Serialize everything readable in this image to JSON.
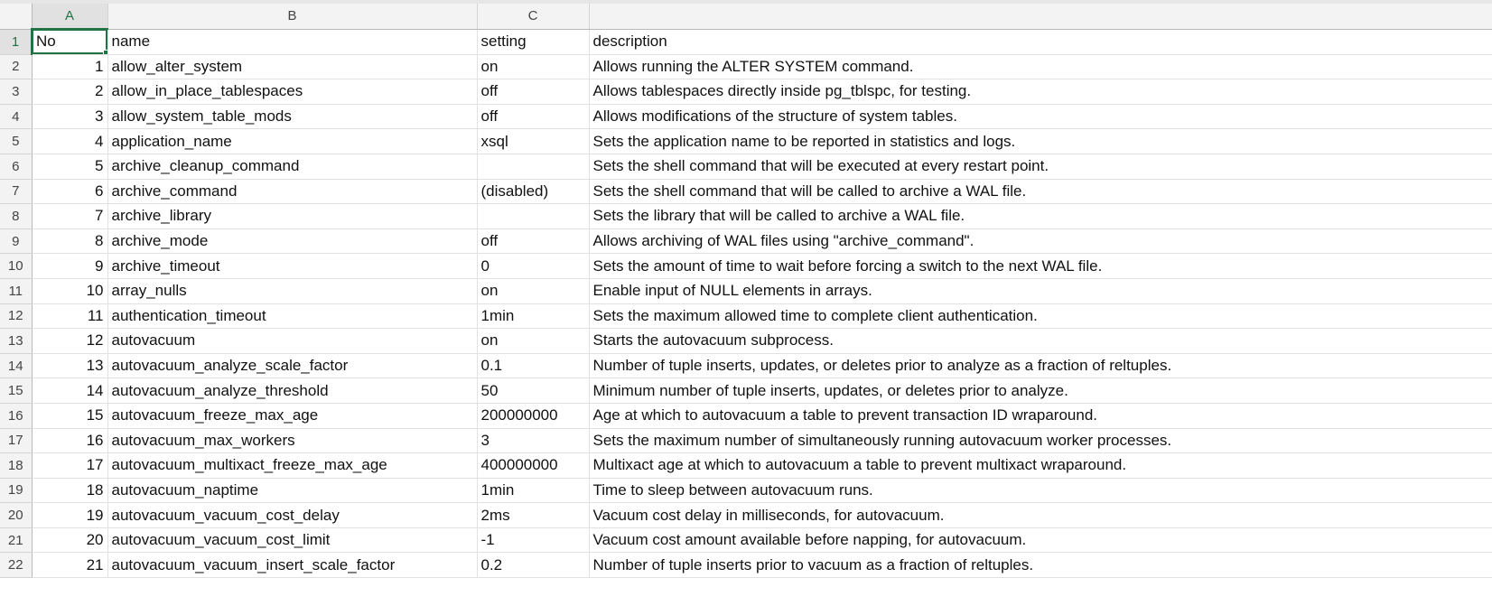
{
  "columns": [
    "A",
    "B",
    "C"
  ],
  "header_row": {
    "row_number": "1",
    "no": "No",
    "name": "name",
    "setting": "setting",
    "description": "description"
  },
  "rows": [
    {
      "row_number": "2",
      "no": "1",
      "name": "allow_alter_system",
      "setting": "on",
      "description": "Allows running the ALTER SYSTEM command."
    },
    {
      "row_number": "3",
      "no": "2",
      "name": "allow_in_place_tablespaces",
      "setting": "off",
      "description": "Allows tablespaces directly inside pg_tblspc, for testing."
    },
    {
      "row_number": "4",
      "no": "3",
      "name": "allow_system_table_mods",
      "setting": "off",
      "description": "Allows modifications of the structure of system tables."
    },
    {
      "row_number": "5",
      "no": "4",
      "name": "application_name",
      "setting": "xsql",
      "description": "Sets the application name to be reported in statistics and logs."
    },
    {
      "row_number": "6",
      "no": "5",
      "name": "archive_cleanup_command",
      "setting": "",
      "description": "Sets the shell command that will be executed at every restart point."
    },
    {
      "row_number": "7",
      "no": "6",
      "name": "archive_command",
      "setting": "(disabled)",
      "description": "Sets the shell command that will be called to archive a WAL file."
    },
    {
      "row_number": "8",
      "no": "7",
      "name": "archive_library",
      "setting": "",
      "description": "Sets the library that will be called to archive a WAL file."
    },
    {
      "row_number": "9",
      "no": "8",
      "name": "archive_mode",
      "setting": "off",
      "description": "Allows archiving of WAL files using \"archive_command\"."
    },
    {
      "row_number": "10",
      "no": "9",
      "name": "archive_timeout",
      "setting": "0",
      "description": "Sets the amount of time to wait before forcing a switch to the next WAL file."
    },
    {
      "row_number": "11",
      "no": "10",
      "name": "array_nulls",
      "setting": "on",
      "description": "Enable input of NULL elements in arrays."
    },
    {
      "row_number": "12",
      "no": "11",
      "name": "authentication_timeout",
      "setting": "1min",
      "description": "Sets the maximum allowed time to complete client authentication."
    },
    {
      "row_number": "13",
      "no": "12",
      "name": "autovacuum",
      "setting": "on",
      "description": "Starts the autovacuum subprocess."
    },
    {
      "row_number": "14",
      "no": "13",
      "name": "autovacuum_analyze_scale_factor",
      "setting": "0.1",
      "description": "Number of tuple inserts, updates, or deletes prior to analyze as a fraction of reltuples."
    },
    {
      "row_number": "15",
      "no": "14",
      "name": "autovacuum_analyze_threshold",
      "setting": "50",
      "description": "Minimum number of tuple inserts, updates, or deletes prior to analyze."
    },
    {
      "row_number": "16",
      "no": "15",
      "name": "autovacuum_freeze_max_age",
      "setting": "200000000",
      "description": "Age at which to autovacuum a table to prevent transaction ID wraparound."
    },
    {
      "row_number": "17",
      "no": "16",
      "name": "autovacuum_max_workers",
      "setting": "3",
      "description": "Sets the maximum number of simultaneously running autovacuum worker processes."
    },
    {
      "row_number": "18",
      "no": "17",
      "name": "autovacuum_multixact_freeze_max_age",
      "setting": "400000000",
      "description": "Multixact age at which to autovacuum a table to prevent multixact wraparound."
    },
    {
      "row_number": "19",
      "no": "18",
      "name": "autovacuum_naptime",
      "setting": "1min",
      "description": "Time to sleep between autovacuum runs."
    },
    {
      "row_number": "20",
      "no": "19",
      "name": "autovacuum_vacuum_cost_delay",
      "setting": "2ms",
      "description": "Vacuum cost delay in milliseconds, for autovacuum."
    },
    {
      "row_number": "21",
      "no": "20",
      "name": "autovacuum_vacuum_cost_limit",
      "setting": "-1",
      "description": "Vacuum cost amount available before napping, for autovacuum."
    },
    {
      "row_number": "22",
      "no": "21",
      "name": "autovacuum_vacuum_insert_scale_factor",
      "setting": "0.2",
      "description": "Number of tuple inserts prior to vacuum as a fraction of reltuples."
    }
  ]
}
